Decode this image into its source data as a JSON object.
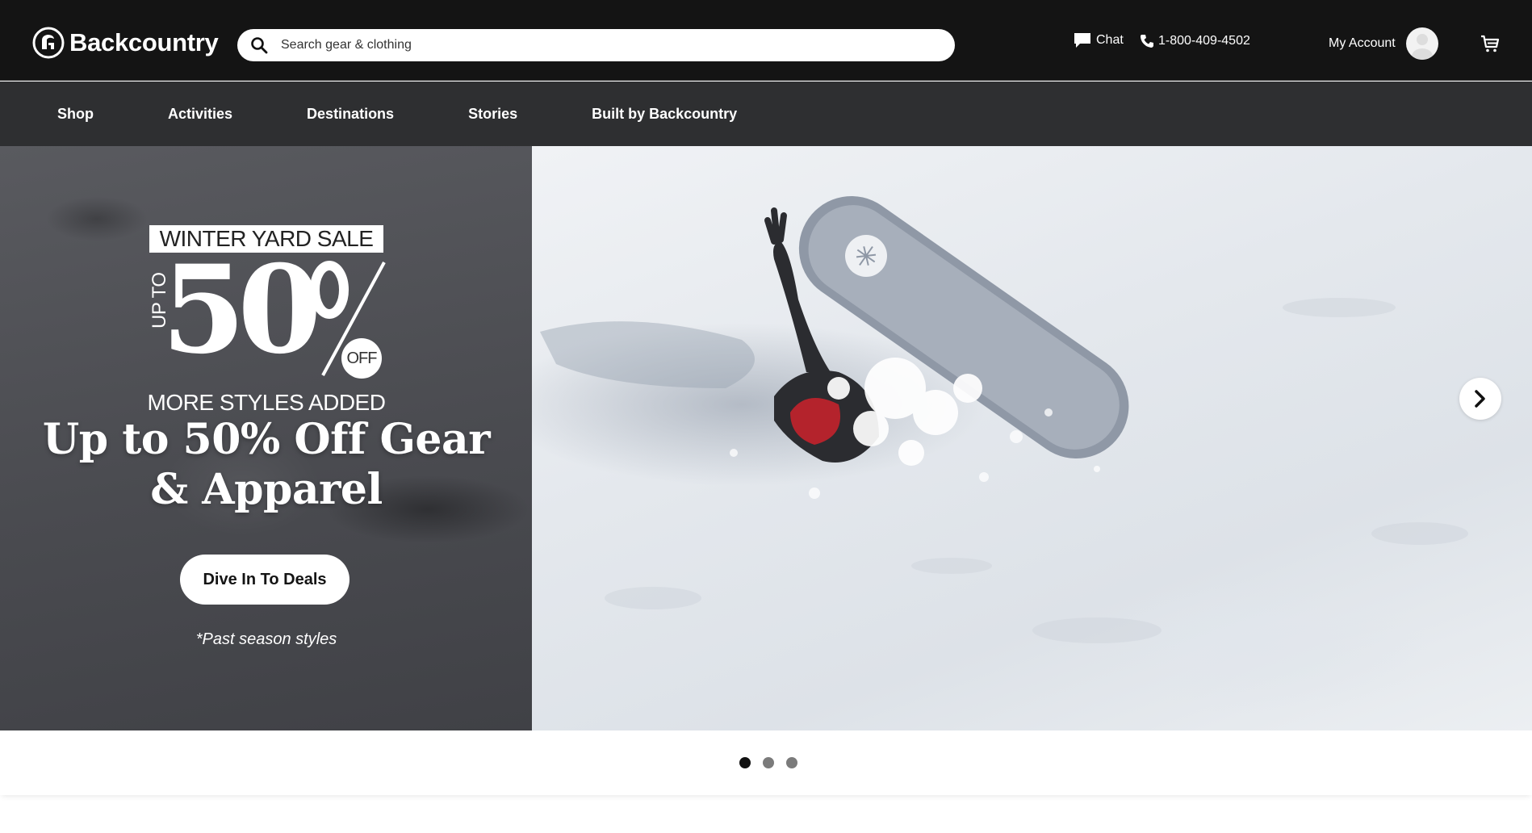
{
  "header": {
    "logo_text": "Backcountry",
    "search": {
      "placeholder": "Search gear & clothing",
      "value": ""
    },
    "chat_label": "Chat",
    "phone_label": "1-800-409-4502",
    "account_label": "My Account"
  },
  "nav": {
    "items": [
      {
        "label": "Shop"
      },
      {
        "label": "Activities"
      },
      {
        "label": "Destinations"
      },
      {
        "label": "Stories"
      },
      {
        "label": "Built by Backcountry"
      }
    ]
  },
  "hero": {
    "badge": {
      "title": "WINTER YARD SALE",
      "up_to": "UP TO",
      "number": "50",
      "off": "OFF",
      "subtitle": "MORE STYLES ADDED"
    },
    "headline": "Up to 50% Off Gear & Apparel",
    "cta_label": "Dive In To Deals",
    "footnote": "*Past season styles"
  },
  "carousel": {
    "slide_count": 3,
    "active_index": 0
  },
  "colors": {
    "header_bg": "#141414",
    "nav_bg": "#2e2f31",
    "hero_left_bg": "#4f5055",
    "dot_active": "#111111",
    "dot_inactive": "#7b7b7b"
  }
}
